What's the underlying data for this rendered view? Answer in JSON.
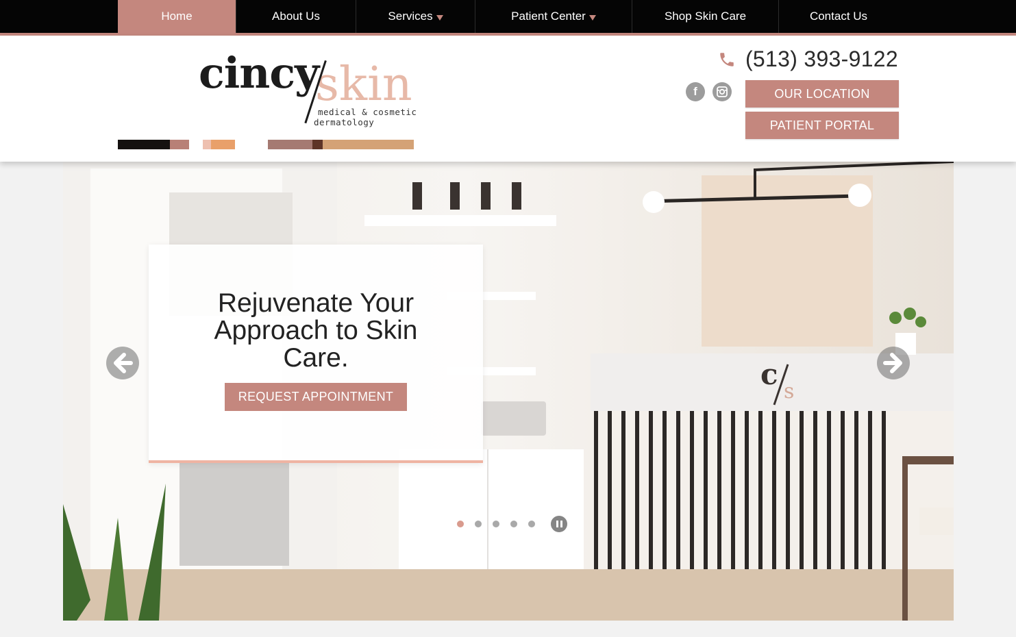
{
  "nav": {
    "items": [
      {
        "label": "Home",
        "active": true,
        "dropdown": false
      },
      {
        "label": "About Us",
        "active": false,
        "dropdown": false
      },
      {
        "label": "Services",
        "active": false,
        "dropdown": true
      },
      {
        "label": "Patient Center",
        "active": false,
        "dropdown": true
      },
      {
        "label": "Shop Skin Care",
        "active": false,
        "dropdown": false
      },
      {
        "label": "Contact Us",
        "active": false,
        "dropdown": false
      }
    ]
  },
  "logo": {
    "word1": "cincy",
    "word2": "skin",
    "tagline1": "medical & cosmetic",
    "tagline2": "dermatology"
  },
  "header": {
    "phone": "(513) 393-9122",
    "phone_icon": "phone-icon",
    "social": [
      {
        "name": "facebook-icon",
        "glyph": "f"
      },
      {
        "name": "instagram-icon",
        "glyph": "◙"
      }
    ],
    "location_button": "OUR LOCATION",
    "portal_button": "PATIENT PORTAL"
  },
  "hero": {
    "heading": "Rejuvenate Your Approach to Skin Care.",
    "button": "REQUEST APPOINTMENT",
    "slide_count": 5,
    "active_slide": 1
  },
  "colors": {
    "accent": "#c4877e",
    "nav_bg": "#050505",
    "logo_pink": "#e7b9a8",
    "card_underline": "#efb4a3"
  }
}
